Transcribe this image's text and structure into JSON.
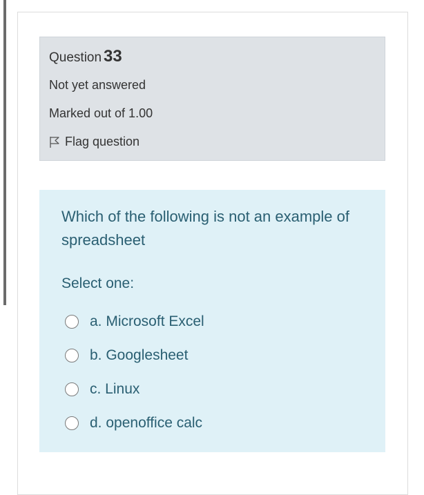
{
  "question": {
    "label": "Question",
    "number": "33",
    "state": "Not yet answered",
    "grade": "Marked out of 1.00",
    "flag_label": "Flag question"
  },
  "content": {
    "text": "Which of the following is not an example of spreadsheet",
    "prompt": "Select one:",
    "options": [
      {
        "label": "a. Microsoft Excel"
      },
      {
        "label": "b. Googlesheet"
      },
      {
        "label": "c. Linux"
      },
      {
        "label": "d. openoffice calc"
      }
    ]
  }
}
